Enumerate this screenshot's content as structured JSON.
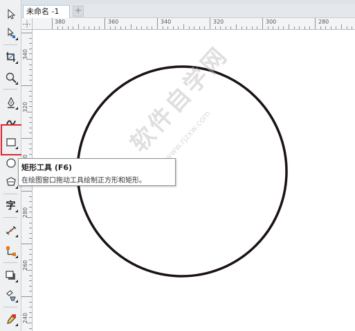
{
  "document": {
    "tab_title": "未命名 -1",
    "add_tab_symbol": "+"
  },
  "toolbar": {
    "tools": [
      {
        "id": "pick",
        "icon": "pointer-arrow-icon",
        "has_flyout": false
      },
      {
        "id": "shape",
        "icon": "shape-node-icon",
        "has_flyout": true
      },
      {
        "id": "crop",
        "icon": "crop-icon",
        "has_flyout": true
      },
      {
        "id": "zoom",
        "icon": "magnifier-icon",
        "has_flyout": true
      },
      {
        "id": "pen",
        "icon": "pen-nib-icon",
        "has_flyout": true
      },
      {
        "id": "artistic",
        "icon": "artistic-media-icon",
        "has_flyout": true
      },
      {
        "id": "rectangle",
        "icon": "rectangle-icon",
        "has_flyout": true,
        "selected": true
      },
      {
        "id": "ellipse",
        "icon": "ellipse-icon",
        "has_flyout": true
      },
      {
        "id": "polygon",
        "icon": "polygon-icon",
        "has_flyout": true
      },
      {
        "id": "text",
        "icon": "text-tool-icon",
        "label": "字",
        "has_flyout": true
      },
      {
        "id": "dimension",
        "icon": "dimension-icon",
        "has_flyout": true
      },
      {
        "id": "connector",
        "icon": "connector-icon",
        "has_flyout": true
      },
      {
        "id": "shadow",
        "icon": "drop-shadow-icon",
        "has_flyout": true
      },
      {
        "id": "transparency",
        "icon": "transparency-icon",
        "has_flyout": true
      },
      {
        "id": "eyedropper",
        "icon": "eyedropper-icon",
        "has_flyout": true
      }
    ]
  },
  "rulers": {
    "horizontal": [
      "380",
      "360",
      "340",
      "320",
      "300",
      "280"
    ],
    "vertical": [
      "340",
      "320",
      "300",
      "280",
      "260",
      "240"
    ]
  },
  "tooltip": {
    "title": "矩形工具 (F6)",
    "description": "在绘图窗口拖动工具绘制正方形和矩形。"
  },
  "watermark": {
    "text": "软件自学网",
    "url": "www.rjzxw.com"
  },
  "colors": {
    "highlight": "#e0252b",
    "circle_stroke": "#1a1311",
    "tab_border": "#9fc5e8"
  }
}
